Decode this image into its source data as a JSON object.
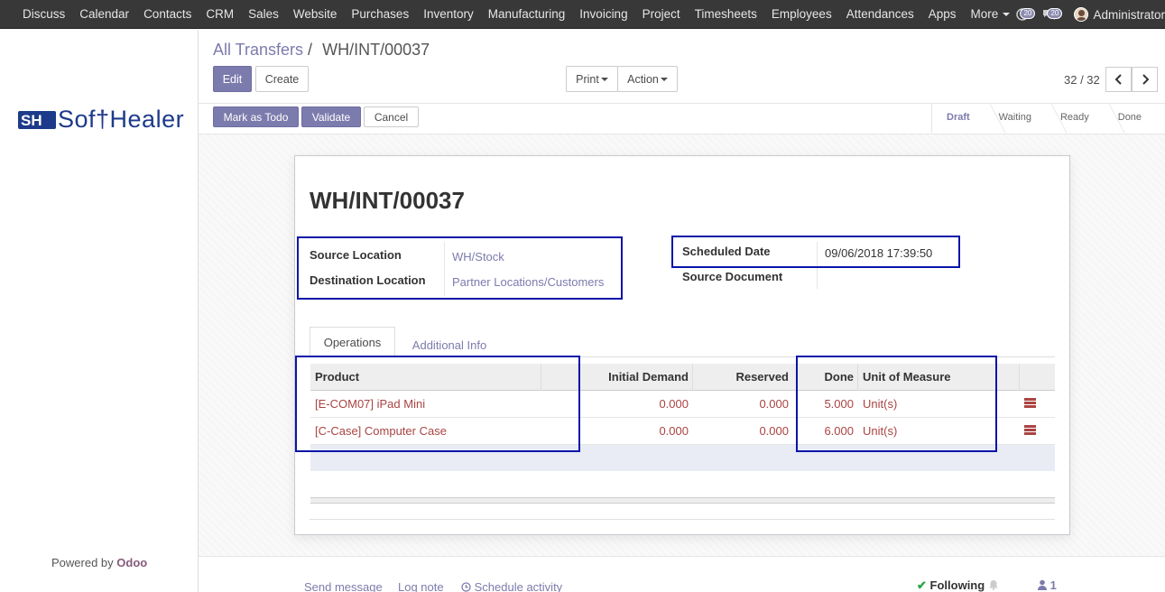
{
  "navbar": {
    "menu": [
      "Discuss",
      "Calendar",
      "Contacts",
      "CRM",
      "Sales",
      "Website",
      "Purchases",
      "Inventory",
      "Manufacturing",
      "Invoicing",
      "Project",
      "Timesheets",
      "Employees",
      "Attendances",
      "Apps",
      "More"
    ],
    "activity_count": "20",
    "message_count": "20",
    "user": "Administrator"
  },
  "sidebar": {
    "logo_text": "Sof†Healer",
    "powered_prefix": "Powered by",
    "powered_brand": "Odoo"
  },
  "breadcrumb": {
    "parent": "All Transfers",
    "separator": "/",
    "current": "WH/INT/00037"
  },
  "toolbar": {
    "edit": "Edit",
    "create": "Create",
    "print": "Print",
    "action": "Action",
    "pager": "32 / 32"
  },
  "actions": {
    "mark_todo": "Mark as Todo",
    "validate": "Validate",
    "cancel": "Cancel"
  },
  "statusbar": {
    "steps": [
      "Draft",
      "Waiting",
      "Ready",
      "Done"
    ],
    "active": "Draft"
  },
  "record": {
    "title": "WH/INT/00037",
    "fields": {
      "source_location_label": "Source Location",
      "source_location": "WH/Stock",
      "destination_location_label": "Destination Location",
      "destination_location": "Partner Locations/Customers",
      "scheduled_date_label": "Scheduled Date",
      "scheduled_date": "09/06/2018 17:39:50",
      "source_document_label": "Source Document",
      "source_document": ""
    }
  },
  "tabs": {
    "operations": "Operations",
    "additional_info": "Additional Info"
  },
  "table": {
    "columns": {
      "product": "Product",
      "initial_demand": "Initial Demand",
      "reserved": "Reserved",
      "done": "Done",
      "uom": "Unit of Measure"
    },
    "rows": [
      {
        "product": "[E-COM07] iPad Mini",
        "initial_demand": "0.000",
        "reserved": "0.000",
        "done": "5.000",
        "uom": "Unit(s)"
      },
      {
        "product": "[C-Case] Computer Case",
        "initial_demand": "0.000",
        "reserved": "0.000",
        "done": "6.000",
        "uom": "Unit(s)"
      }
    ]
  },
  "chatter": {
    "send_message": "Send message",
    "log_note": "Log note",
    "schedule_activity": "Schedule activity",
    "following": "Following",
    "followers_count": "1"
  },
  "colors": {
    "primary": "#7c7bad",
    "navbar": "#383838",
    "highlight_box": "#0a14a8",
    "row_text": "#a94442"
  }
}
